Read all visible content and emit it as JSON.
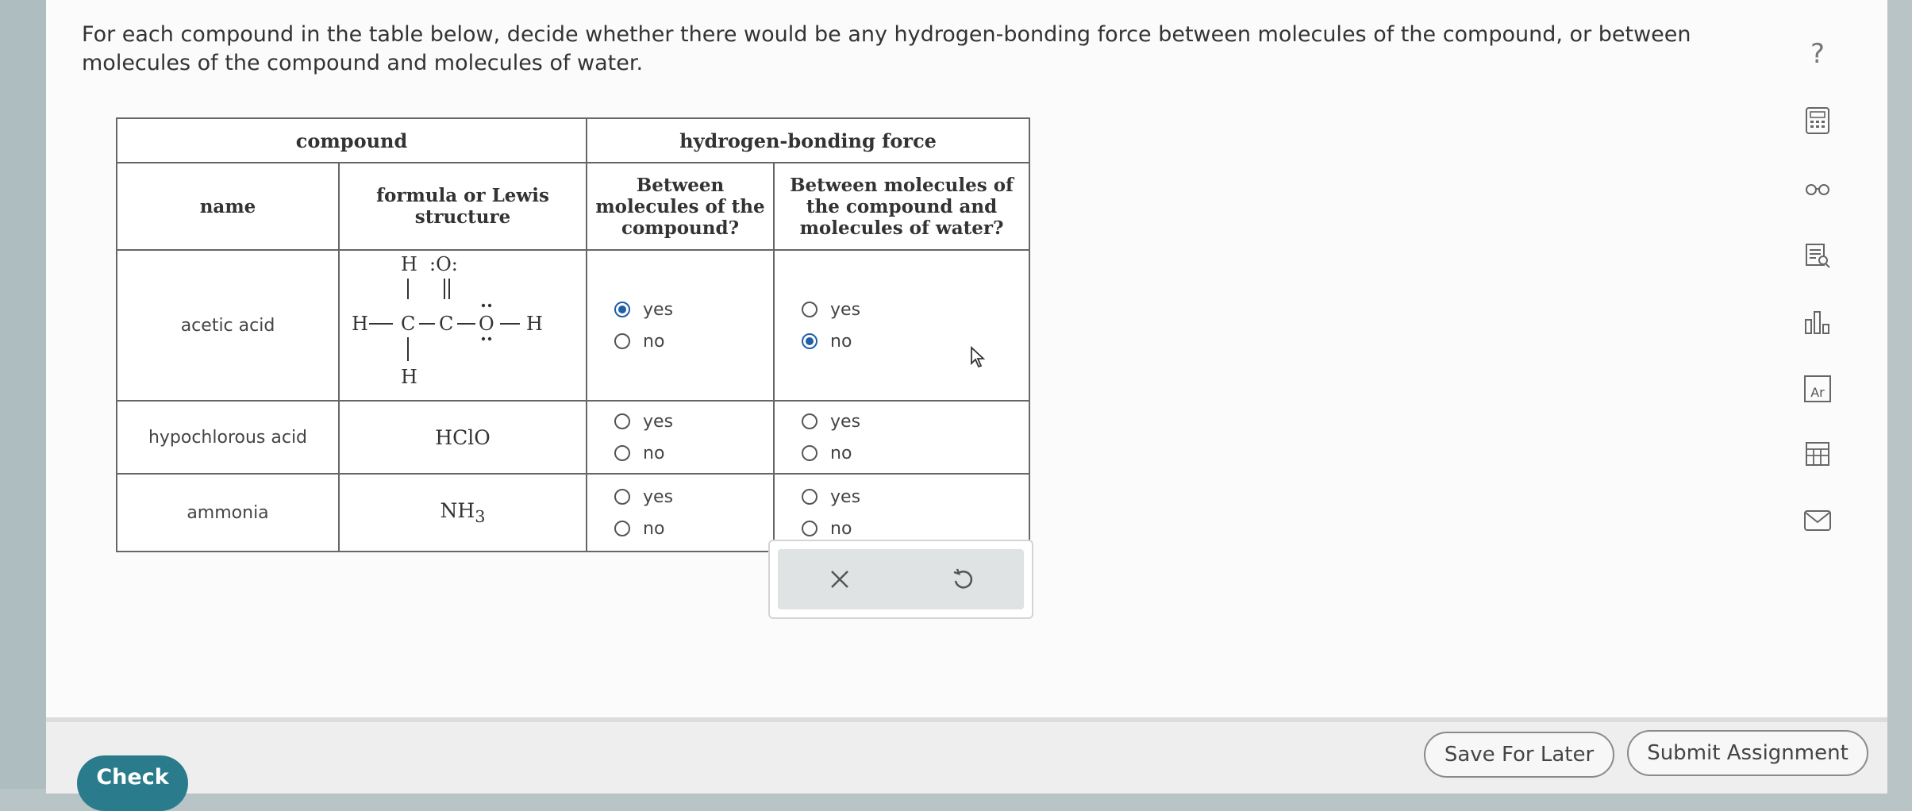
{
  "question": {
    "text": "For each compound in the table below, decide whether there would be any hydrogen-bonding force between molecules of the compound, or between molecules of the compound and molecules of water."
  },
  "table": {
    "compound_header": "compound",
    "hbond_header": "hydrogen-bonding force",
    "col_name": "name",
    "col_formula": "formula or Lewis structure",
    "col_between_compound": "Between molecules of the compound?",
    "col_between_water": "Between molecules of the compound and molecules of water?",
    "rows": [
      {
        "name": "acetic acid",
        "formula": "",
        "lewis": {
          "h_top": "H",
          "o_top": ":O:",
          "h_left": "H",
          "c1": "C",
          "c2": "C",
          "o_right": "O",
          "h_right": "H",
          "h_bottom": "H"
        },
        "compound": {
          "yes_label": "yes",
          "no_label": "no",
          "selected": "yes"
        },
        "water": {
          "yes_label": "yes",
          "no_label": "no",
          "selected": "no"
        }
      },
      {
        "name": "hypochlorous acid",
        "formula": "HClO",
        "compound": {
          "yes_label": "yes",
          "no_label": "no",
          "selected": ""
        },
        "water": {
          "yes_label": "yes",
          "no_label": "no",
          "selected": ""
        }
      },
      {
        "name": "ammonia",
        "formula": "NH",
        "formula_sub": "3",
        "compound": {
          "yes_label": "yes",
          "no_label": "no",
          "selected": ""
        },
        "water": {
          "yes_label": "yes",
          "no_label": "no",
          "selected": ""
        }
      }
    ]
  },
  "actions": {
    "clear_icon": "x-icon",
    "reset_icon": "undo-icon"
  },
  "toolbar": {
    "help_label": "?",
    "icons": [
      "calculator-icon",
      "glasses-icon",
      "reference-icon",
      "chart-icon",
      "periodic-table-icon",
      "data-table-icon",
      "mail-icon"
    ],
    "periodic_label": "Ar"
  },
  "footer": {
    "check_label": "Check",
    "save_label": "Save For Later",
    "submit_label": "Submit Assignment"
  },
  "colors": {
    "accent": "#2a7c8c",
    "radio_selected": "#1f5fa8"
  }
}
